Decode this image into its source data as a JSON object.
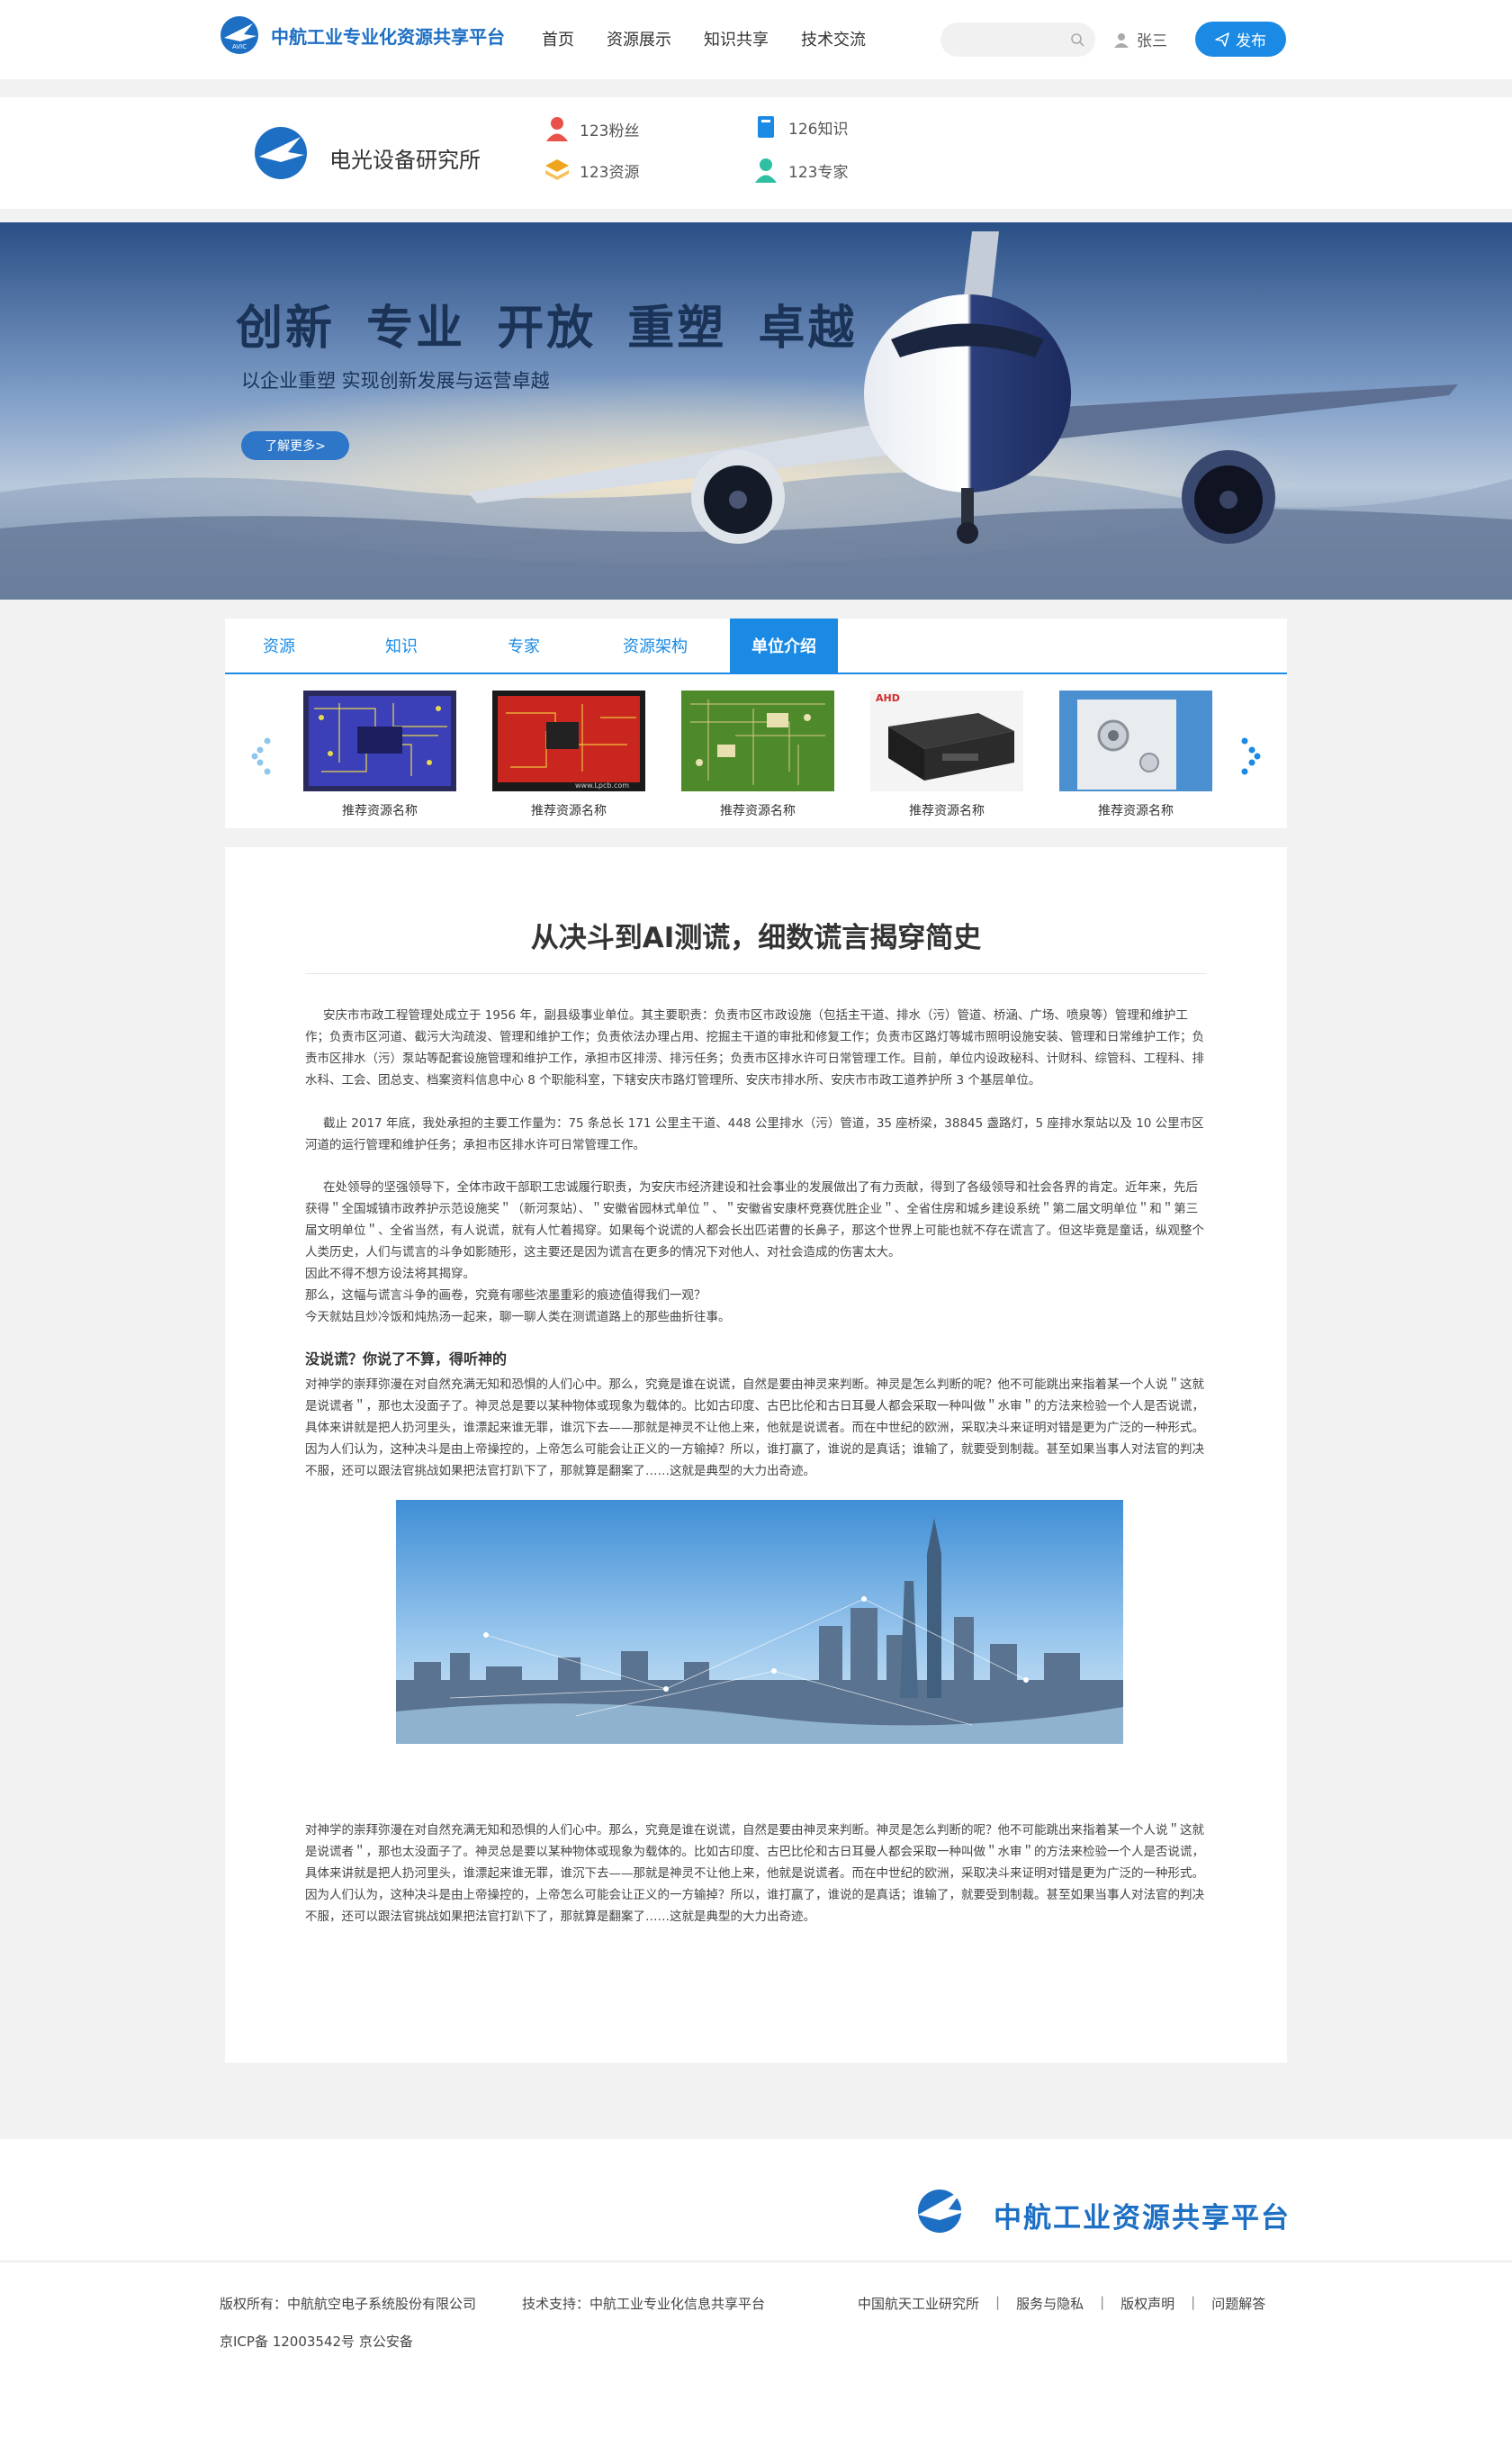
{
  "header": {
    "logo_text": "中航工业专业化资源共享平台",
    "logo_badge": "AVIC",
    "nav": [
      "首页",
      "资源展示",
      "知识共享",
      "技术交流"
    ],
    "search_placeholder": "",
    "user_name": "张三",
    "publish_label": "发布"
  },
  "org": {
    "name": "电光设备研究所",
    "stats": [
      {
        "icon": "fans-icon",
        "label": "123粉丝",
        "color": "#e8524a"
      },
      {
        "icon": "knowledge-icon",
        "label": "126知识",
        "color": "#1a8ae4"
      },
      {
        "icon": "resource-icon",
        "label": "123资源",
        "color": "#f0a51f"
      },
      {
        "icon": "expert-icon",
        "label": "123专家",
        "color": "#2fc0a4"
      }
    ]
  },
  "banner": {
    "title": "创新 专业 开放 重塑 卓越",
    "subtitle": "以企业重塑 实现创新发展与运营卓越",
    "button": "了解更多>"
  },
  "tabs": {
    "items": [
      "资源",
      "知识",
      "专家",
      "资源架构",
      "单位介绍"
    ],
    "active": "单位介绍"
  },
  "carousel": {
    "items": [
      {
        "caption": "推荐资源名称",
        "image": "pcb-blue"
      },
      {
        "caption": "推荐资源名称",
        "image": "pcb-red",
        "watermark": "www.Lpcb.com"
      },
      {
        "caption": "推荐资源名称",
        "image": "pcb-green"
      },
      {
        "caption": "推荐资源名称",
        "image": "dvr-device",
        "watermark": "AHD"
      },
      {
        "caption": "推荐资源名称",
        "image": "machine-part"
      }
    ]
  },
  "article": {
    "title": "从决斗到AI测谎，细数谎言揭穿简史",
    "p1": "安庆市市政工程管理处成立于 1956 年，副县级事业单位。其主要职责：负责市区市政设施（包括主干道、排水（污）管道、桥涵、广场、喷泉等）管理和维护工作；负责市区河道、截污大沟疏浚、管理和维护工作；负责依法办理占用、挖掘主干道的审批和修复工作；负责市区路灯等城市照明设施安装、管理和日常维护工作；负责市区排水（污）泵站等配套设施管理和维护工作，承担市区排涝、排污任务；负责市区排水许可日常管理工作。目前，单位内设政秘科、计财科、综管科、工程科、排水科、工会、团总支、档案资料信息中心 8 个职能科室，下辖安庆市路灯管理所、安庆市排水所、安庆市市政工道养护所 3 个基层单位。",
    "p2": "截止 2017 年底，我处承担的主要工作量为：75 条总长 171 公里主干道、448 公里排水（污）管道，35 座桥梁，38845 盏路灯，5 座排水泵站以及 10 公里市区河道的运行管理和维护任务；承担市区排水许可日常管理工作。",
    "p3": "在处领导的坚强领导下，全体市政干部职工忠诚履行职责，为安庆市经济建设和社会事业的发展做出了有力贡献，得到了各级领导和社会各界的肯定。近年来，先后获得＂全国城镇市政养护示范设施奖＂（新河泵站）、＂安徽省园林式单位＂、＂安徽省安康杯竞赛优胜企业＂、全省住房和城乡建设系统＂第二届文明单位＂和＂第三届文明单位＂、全省当然，有人说谎，就有人忙着揭穿。如果每个说谎的人都会长出匹诺曹的长鼻子，那这个世界上可能也就不存在谎言了。但这毕竟是童话，纵观整个人类历史，人们与谎言的斗争如影随形，这主要还是因为谎言在更多的情况下对他人、对社会造成的伤害太大。",
    "p4": "因此不得不想方设法将其揭穿。",
    "p5": "那么，这幅与谎言斗争的画卷，究竟有哪些浓墨重彩的痕迹值得我们一观？",
    "p6": "今天就姑且炒冷饭和炖热汤一起来，聊一聊人类在测谎道路上的那些曲折往事。",
    "subhead": "没说谎？你说了不算，得听神的",
    "p7": "对神学的崇拜弥漫在对自然充满无知和恐惧的人们心中。那么，究竟是谁在说谎，自然是要由神灵来判断。神灵是怎么判断的呢？他不可能跳出来指着某一个人说＂这就是说谎者＂，那也太没面子了。神灵总是要以某种物体或现象为载体的。比如古印度、古巴比伦和古日耳曼人都会采取一种叫做＂水审＂的方法来检验一个人是否说谎，具体来讲就是把人扔河里头，谁漂起来谁无罪，谁沉下去——那就是神灵不让他上来，他就是说谎者。而在中世纪的欧洲，采取决斗来证明对错是更为广泛的一种形式。因为人们认为，这种决斗是由上帝操控的，上帝怎么可能会让正义的一方输掉？所以，谁打赢了，谁说的是真话；谁输了，就要受到制裁。甚至如果当事人对法官的判决不服，还可以跟法官挑战如果把法官打趴下了，那就算是翻案了……这就是典型的大力出奇迹。",
    "p8": "对神学的崇拜弥漫在对自然充满无知和恐惧的人们心中。那么，究竟是谁在说谎，自然是要由神灵来判断。神灵是怎么判断的呢？他不可能跳出来指着某一个人说＂这就是说谎者＂，那也太没面子了。神灵总是要以某种物体或现象为载体的。比如古印度、古巴比伦和古日耳曼人都会采取一种叫做＂水审＂的方法来检验一个人是否说谎，具体来讲就是把人扔河里头，谁漂起来谁无罪，谁沉下去——那就是神灵不让他上来，他就是说谎者。而在中世纪的欧洲，采取决斗来证明对错是更为广泛的一种形式。因为人们认为，这种决斗是由上帝操控的，上帝怎么可能会让正义的一方输掉？所以，谁打赢了，谁说的是真话；谁输了，就要受到制裁。甚至如果当事人对法官的判决不服，还可以跟法官挑战如果把法官打趴下了，那就算是翻案了……这就是典型的大力出奇迹。"
  },
  "footer": {
    "brand_name": "中航工业资源共享平台",
    "copyright": "版权所有：中航航空电子系统股份有限公司",
    "support": "技术支持：中航工业专业化信息共享平台",
    "icp": "京ICP备 12003542号 京公安备",
    "links": [
      "中国航天工业研究所",
      "服务与隐私",
      "版权声明",
      "问题解答"
    ]
  },
  "colors": {
    "primary": "#1a8ae4",
    "brand": "#1d6fc4",
    "banner_text": "#1a3357"
  }
}
